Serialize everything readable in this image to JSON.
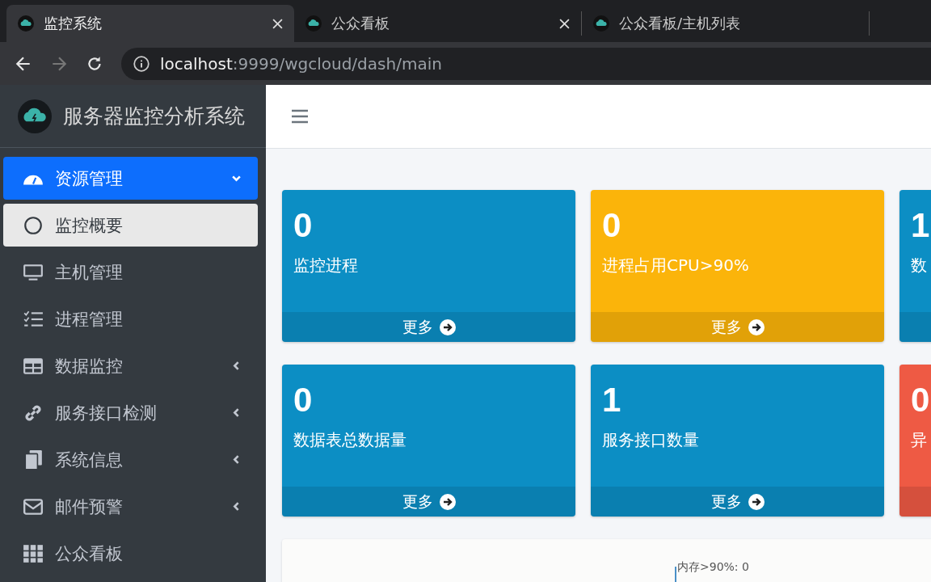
{
  "browser": {
    "tabs": [
      {
        "title": "监控系统",
        "selected": true
      },
      {
        "title": "公众看板",
        "selected": false
      },
      {
        "title": "公众看板/主机列表",
        "selected": false
      }
    ],
    "address": {
      "host": "localhost",
      "path": ":9999/wgcloud/dash/main"
    }
  },
  "sidebar": {
    "brand": "服务器监控分析系统",
    "items": [
      {
        "label": "资源管理",
        "selected": true,
        "expanded": true,
        "has_children": true,
        "children": [
          {
            "label": "监控概要",
            "selected": true
          }
        ]
      },
      {
        "label": "主机管理",
        "selected": false,
        "has_children": false
      },
      {
        "label": "进程管理",
        "selected": false,
        "has_children": false
      },
      {
        "label": "数据监控",
        "selected": false,
        "expanded": false,
        "has_children": true
      },
      {
        "label": "服务接口检测",
        "selected": false,
        "expanded": false,
        "has_children": true
      },
      {
        "label": "系统信息",
        "selected": false,
        "expanded": false,
        "has_children": true
      },
      {
        "label": "邮件预警",
        "selected": false,
        "expanded": false,
        "has_children": true
      },
      {
        "label": "公众看板",
        "selected": false,
        "has_children": false
      }
    ]
  },
  "tiles": [
    {
      "value": "0",
      "label": "监控进程",
      "more": "更多",
      "color": "#0c8ec4"
    },
    {
      "value": "0",
      "label": "进程占用CPU>90%",
      "more": "更多",
      "color": "#fbb40a"
    },
    {
      "value": "1",
      "label": "数",
      "color": "#0c8ec4"
    },
    {
      "value": "0",
      "label": "数据表总数据量",
      "more": "更多",
      "color": "#0c8ec4"
    },
    {
      "value": "1",
      "label": "服务接口数量",
      "more": "更多",
      "color": "#0c8ec4"
    },
    {
      "value": "0",
      "label": "异",
      "color": "#ee5a44"
    }
  ],
  "chart_card": {
    "legend": "内存>90%: 0"
  }
}
